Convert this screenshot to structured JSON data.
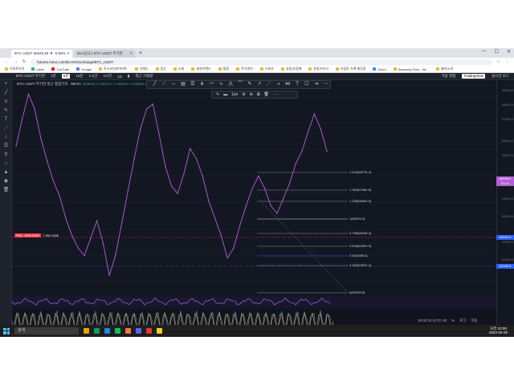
{
  "browser": {
    "tabs": [
      {
        "label": "BTC USDT 66545.59 ▼ -0.89%",
        "active": true
      },
      {
        "label": "66.6입고 | BTC USDT 무기한",
        "active": false
      }
    ],
    "url": "futures.mexc.com/ko-KR/exchange/BTC_USDT",
    "bookmarks": [
      "이마트리악",
      "naver",
      "YouTube",
      "Google",
      "토스코인바이비트",
      "가계도",
      "업무",
      "소창",
      "세자브랜드",
      "통합",
      "주식관리",
      "스포츠",
      "부동산/경제",
      "유튜브지식",
      "크립토 가계 재무용",
      "Zoom",
      "Samsung Flow - Wi...",
      "재미/소리"
    ]
  },
  "tv": {
    "timeframes": [
      "1분",
      "5분",
      "15분",
      "1시간",
      "4시간",
      "1D"
    ],
    "active_timeframe": "5분",
    "symbol_header": "BTC USDT 무기한",
    "indicator_label": "최근 거래량",
    "right_items": [
      "가용 경험",
      "TradingView",
      "실시간 모드"
    ],
    "legend": "BTC USDT 무기한 최근 종합가치 · MEXC",
    "legend_values": "O66641.4  H66711.7  L66543.4  C66545.6",
    "draw_style_label": "1px",
    "pnl_label": "PNL: 1256.0960",
    "pnl_value": "7 260.1840"
  },
  "price_axis": {
    "ticks": [
      "69000.0",
      "68000.0",
      "67000.0",
      "66000.0",
      "65000.0",
      "64000.0",
      "63000.0",
      "62000.0",
      "61000.0"
    ],
    "current_price": "66545.6",
    "current_time": "03:44",
    "position_price": "64094.5",
    "low_tag": "62399.5"
  },
  "fib_levels": [
    {
      "label": "1.618(68734.4)"
    },
    {
      "label": "1.382(67984.8)"
    },
    {
      "label": "1.236(66994.9)"
    },
    {
      "label": "1(66094.9)"
    },
    {
      "label": "0.786(65298.3)"
    },
    {
      "label": "0.618(64829.9)"
    },
    {
      "label": "0.5(64388.3)"
    },
    {
      "label": "0.382(63931.4)"
    },
    {
      "label": "0(62399.5)"
    }
  ],
  "x_axis": {
    "ticks": [
      "18",
      "19",
      "20",
      "21",
      "22",
      "23",
      "24",
      "25",
      "26",
      "27",
      "28",
      "10:00"
    ],
    "highlight_start": "2024-03-23  15:45:00",
    "highlight_end": "2024-03-26  01:55:00"
  },
  "footer": {
    "time": "10:00:31 (UTC+9)",
    "pct": "%",
    "log": "로그",
    "auto": "자동"
  },
  "taskbar": {
    "search": "검색",
    "clock_time": "오전 10:00",
    "clock_date": "2024-03-25"
  },
  "chart_data": {
    "type": "line",
    "title": "",
    "xlabel": "",
    "ylabel": "",
    "ylim": [
      61000,
      69200
    ],
    "series": [
      {
        "values": [
          66800,
          67900,
          68900,
          68300,
          67100,
          66200,
          65400,
          64800,
          63900,
          63200,
          62700,
          62400,
          63100,
          63800,
          62900,
          61600,
          62400,
          63700,
          65000,
          66300,
          67500,
          68300,
          68500,
          67300,
          66000,
          65200,
          64900,
          65700,
          66700,
          66300,
          65600,
          64600,
          63900,
          63200,
          62300,
          62700,
          63600,
          64400,
          65100,
          65600,
          65100,
          64400,
          64100,
          64700,
          65300,
          66100,
          66600,
          67400,
          68100,
          67500,
          66600
        ]
      }
    ],
    "colors": {
      "line": "#b25fd6",
      "fib": "#8a8d95",
      "position": "#2962ff"
    }
  }
}
